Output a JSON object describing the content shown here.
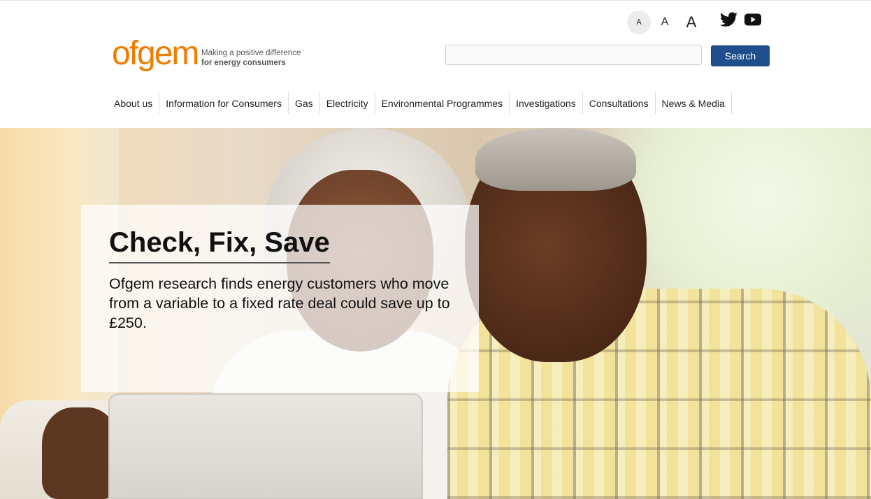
{
  "accessibility": {
    "font_small": "A",
    "font_medium": "A",
    "font_large": "A"
  },
  "social": {
    "twitter_icon": "twitter-icon",
    "youtube_icon": "youtube-icon"
  },
  "brand": {
    "logo_text": "ofgem",
    "tagline_line1": "Making a positive difference",
    "tagline_line2": "for energy consumers",
    "accent_color": "#f07d00"
  },
  "search": {
    "value": "",
    "placeholder": "",
    "button_label": "Search",
    "button_color": "#1e4f8c"
  },
  "nav": {
    "items": [
      {
        "label": "About us"
      },
      {
        "label": "Information for Consumers"
      },
      {
        "label": "Gas"
      },
      {
        "label": "Electricity"
      },
      {
        "label": "Environmental Programmes"
      },
      {
        "label": "Investigations"
      },
      {
        "label": "Consultations"
      },
      {
        "label": "News & Media"
      }
    ]
  },
  "hero": {
    "title": "Check, Fix, Save",
    "text": "Ofgem research finds energy customers who move from a variable to a fixed rate deal could save up to £250."
  }
}
